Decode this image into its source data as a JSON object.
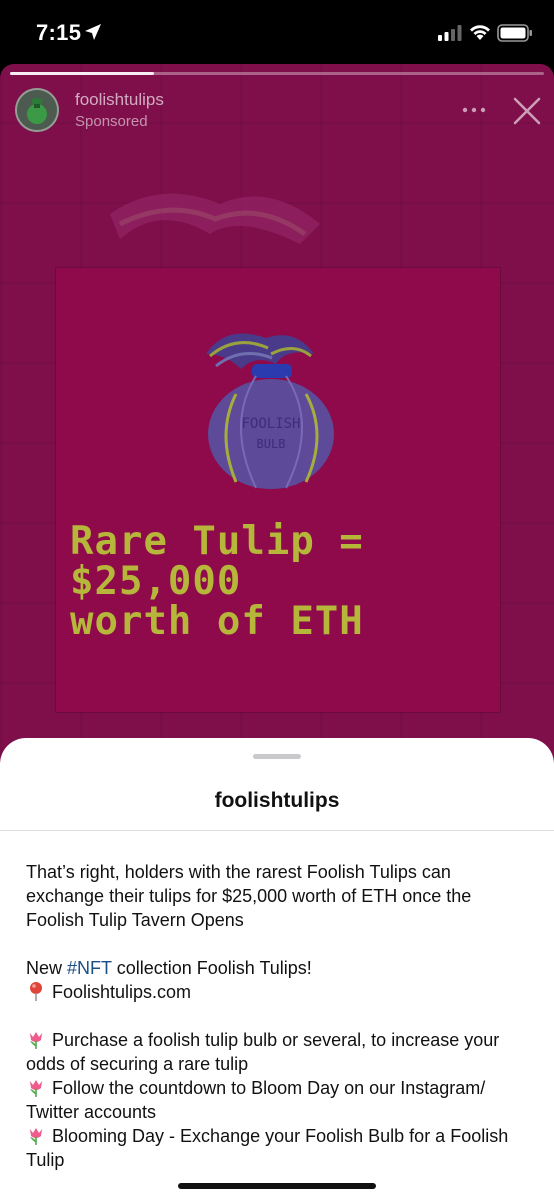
{
  "status_bar": {
    "time": "7:15"
  },
  "story": {
    "progress_fraction": 0.27,
    "username": "foolishtulips",
    "sponsored_label": "Sponsored",
    "headline_lines": [
      "Rare Tulip =",
      "$25,000",
      "worth of ETH"
    ],
    "bulb_label_lines": [
      "FOOLISH",
      "BULB"
    ],
    "colors": {
      "background": "#7e0f4b",
      "card": "#8e0a4a",
      "headline": "#b6b63a"
    }
  },
  "sheet": {
    "title": "foolishtulips",
    "caption": {
      "intro": "That’s right, holders with the rarest Foolish Tulips can exchange their tulips for $25,000 worth of ETH once the Foolish Tulip Tavern Opens",
      "new_prefix": "New ",
      "hashtag": "#NFT",
      "new_suffix": " collection Foolish Tulips!",
      "website": "Foolishtulips.com",
      "steps": [
        "Purchase a foolish tulip bulb or several, to increase your odds of securing a rare tulip",
        "Follow the countdown to Bloom Day on our Instagram/ Twitter accounts",
        "Blooming Day - Exchange your Foolish Bulb for a Foolish Tulip"
      ]
    },
    "colors": {
      "hashtag": "#1a4f86"
    }
  },
  "icons": {
    "location": "location-arrow-icon",
    "signal": "cellular-signal-icon",
    "wifi": "wifi-icon",
    "battery": "battery-icon",
    "more": "more-dots-icon",
    "close": "close-icon",
    "pin": "pushpin-icon",
    "tulip": "tulip-icon"
  }
}
